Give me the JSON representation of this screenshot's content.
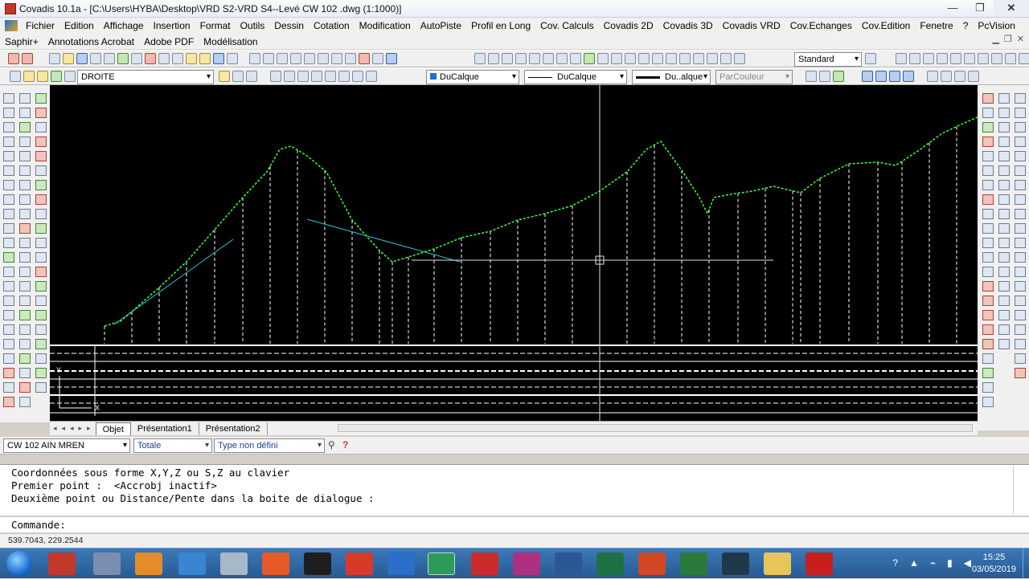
{
  "window": {
    "title": "Covadis 10.1a - [C:\\Users\\HYBA\\Desktop\\VRD S2-VRD S4--Levé CW 102 .dwg (1:1000)]",
    "minimize": "—",
    "maximize": "❐",
    "close": "✕"
  },
  "menu": {
    "items": [
      "Fichier",
      "Edition",
      "Affichage",
      "Insertion",
      "Format",
      "Outils",
      "Dessin",
      "Cotation",
      "Modification",
      "AutoPiste",
      "Profil en Long",
      "Cov. Calculs",
      "Covadis 2D",
      "Covadis 3D",
      "Covadis VRD",
      "Cov.Echanges",
      "Cov.Edition",
      "Fenetre",
      "?",
      "PcVision"
    ],
    "items2": [
      "Saphir+",
      "Annotations Acrobat",
      "Adobe PDF",
      "Modélisation"
    ]
  },
  "toolbar": {
    "text_style": "Standard",
    "layer": "DROITE",
    "color": "DuCalque",
    "linetype": "DuCalque",
    "lineweight": "Du..alque",
    "plotstyle": "ParCouleur"
  },
  "tabs": {
    "nav": "◂◂◂▸▸",
    "items": [
      "Objet",
      "Présentation1",
      "Présentation2"
    ]
  },
  "status": {
    "drawing_combo": "CW 102 AIN MREN",
    "view_combo": "Totale",
    "type_combo": "Type non défini"
  },
  "command": {
    "line1": "Coordonnées sous forme X,Y,Z ou S,Z au clavier",
    "line2": "Premier point :  <Accrobj inactif>",
    "line3": "Deuxième point ou Distance/Pente dans la boite de dialogue :",
    "prompt": "Commande:"
  },
  "coords": "539.7043, 229.2544",
  "taskbar": {
    "time": "15:25",
    "date": "03/05/2019"
  },
  "colors": {
    "profile_line": "#3cff3c",
    "cyan_line": "#2fc4d6",
    "canvas_bg": "#000000"
  }
}
